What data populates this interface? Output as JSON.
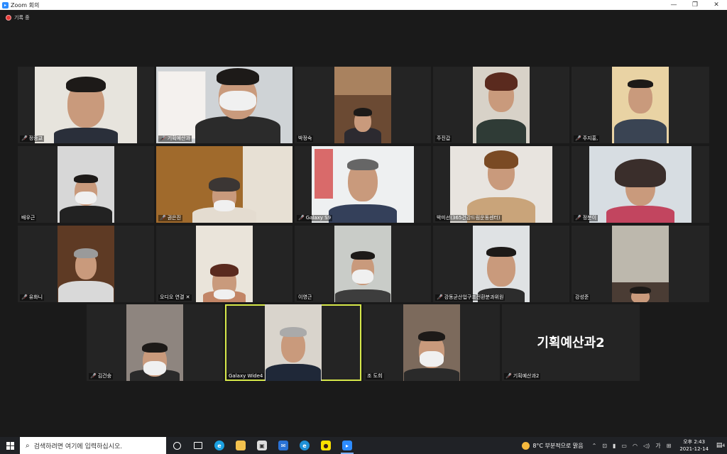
{
  "window": {
    "title": "Zoom 회의",
    "minimize": "—",
    "restore": "❐",
    "close": "✕"
  },
  "recording": {
    "label": "기록 중"
  },
  "participants": [
    {
      "name": "정종교",
      "muted": true
    },
    {
      "name": "기획예산과",
      "muted": true
    },
    {
      "name": "박정숙",
      "muted": false
    },
    {
      "name": "주진갑",
      "muted": false
    },
    {
      "name": "주지홍,",
      "muted": true
    },
    {
      "name": "배우근",
      "muted": false
    },
    {
      "name": "권은진",
      "muted": true
    },
    {
      "name": "Galaxy S9",
      "muted": true
    },
    {
      "name": "박미선(365건강드림운동센터)",
      "muted": false
    },
    {
      "name": "정분이",
      "muted": true
    },
    {
      "name": "유화니",
      "muted": true
    },
    {
      "name": "오디오 연결",
      "muted": false
    },
    {
      "name": "이영근",
      "muted": false
    },
    {
      "name": "강동균산업구조전환분과위원",
      "muted": true
    },
    {
      "name": "강성준",
      "muted": false
    },
    {
      "name": "김건숭",
      "muted": true
    },
    {
      "name": "Galaxy Wide4",
      "muted": false
    },
    {
      "name": "조 도희",
      "muted": false
    },
    {
      "name": "기획예산과2",
      "muted": true,
      "big_label": "기획예산과2"
    }
  ],
  "audio_disconnected_icon": "✕",
  "taskbar": {
    "search_placeholder": "검색하려면 여기에 입력하십시오.",
    "weather": "8°C  부분적으로 맑음",
    "ime": "가",
    "time": "오후 2:43",
    "date": "2021-12-14",
    "notification_count": "4"
  },
  "colors": {
    "active_speaker": "#d6e84a",
    "muted_icon": "#e53935",
    "zoom_blue": "#2d8cff"
  }
}
